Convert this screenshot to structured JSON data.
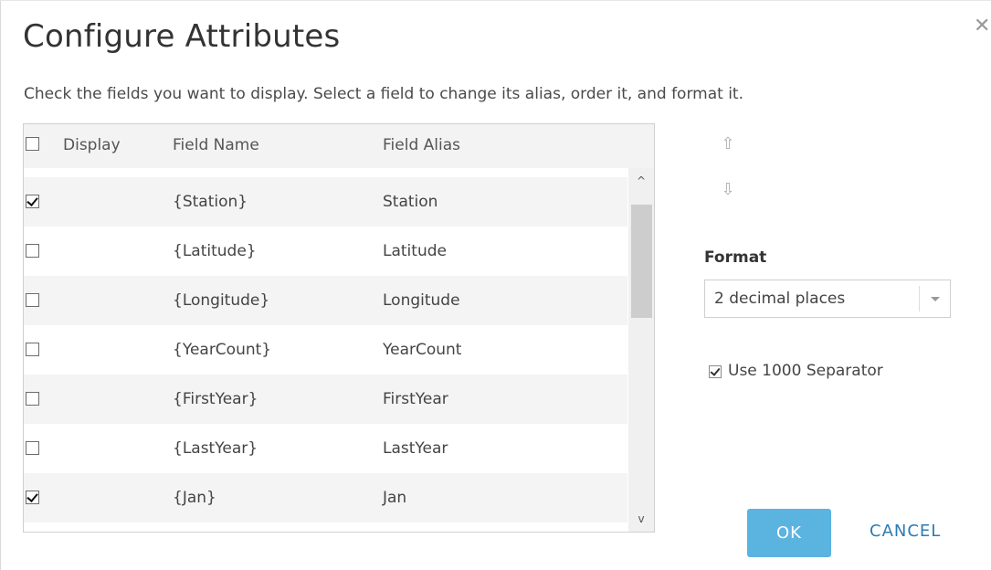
{
  "dialog": {
    "title": "Configure Attributes",
    "close_icon": "close-icon",
    "instructions": "Check the fields you want to display. Select a field to change its alias, order it, and format it."
  },
  "table": {
    "headers": {
      "display": "Display",
      "field_name": "Field Name",
      "field_alias": "Field Alias"
    },
    "select_all_checked": false,
    "rows": [
      {
        "checked": true,
        "name": "{Station}",
        "alias": "Station"
      },
      {
        "checked": false,
        "name": "{Latitude}",
        "alias": "Latitude"
      },
      {
        "checked": false,
        "name": "{Longitude}",
        "alias": "Longitude"
      },
      {
        "checked": false,
        "name": "{YearCount}",
        "alias": "YearCount"
      },
      {
        "checked": false,
        "name": "{FirstYear}",
        "alias": "FirstYear"
      },
      {
        "checked": false,
        "name": "{LastYear}",
        "alias": "LastYear"
      },
      {
        "checked": true,
        "name": "{Jan}",
        "alias": "Jan"
      }
    ]
  },
  "side": {
    "move_up_icon": "arrow-up-icon",
    "move_down_icon": "arrow-down-icon",
    "format_label": "Format",
    "format_value": "2 decimal places",
    "separator_checked": true,
    "separator_label": "Use 1000 Separator"
  },
  "buttons": {
    "ok": "OK",
    "cancel": "CANCEL"
  },
  "colors": {
    "primary_button": "#5bb3e0",
    "link": "#2b7bb5",
    "row_alt": "#f4f4f4"
  }
}
